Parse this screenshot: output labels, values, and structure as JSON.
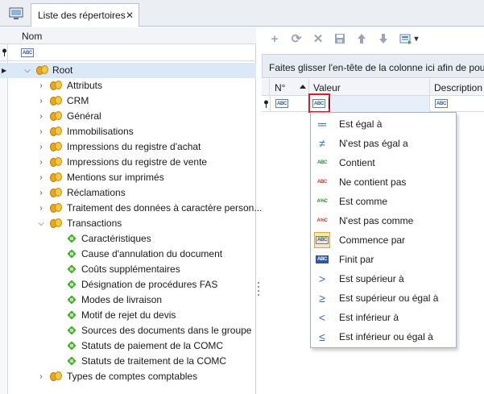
{
  "tabs": {
    "active_label": "Liste des répertoires",
    "close_glyph": "✕",
    "home_icon": "desktop-icon"
  },
  "tree": {
    "column_header": "Nom",
    "filter_icon": "abc-filter-icon",
    "root_label": "Root",
    "nodes": [
      {
        "label": "Attributs",
        "type": "folder",
        "level": 1,
        "expanded": false
      },
      {
        "label": "CRM",
        "type": "folder",
        "level": 1,
        "expanded": false
      },
      {
        "label": "Général",
        "type": "folder",
        "level": 1,
        "expanded": false
      },
      {
        "label": "Immobilisations",
        "type": "folder",
        "level": 1,
        "expanded": false
      },
      {
        "label": "Impressions du registre d'achat",
        "type": "folder",
        "level": 1,
        "expanded": false
      },
      {
        "label": "Impressions du registre de vente",
        "type": "folder",
        "level": 1,
        "expanded": false
      },
      {
        "label": "Mentions sur imprimés",
        "type": "folder",
        "level": 1,
        "expanded": false
      },
      {
        "label": "Réclamations",
        "type": "folder",
        "level": 1,
        "expanded": false
      },
      {
        "label": "Traitement des données à caractère person...",
        "type": "folder",
        "level": 1,
        "expanded": false
      },
      {
        "label": "Transactions",
        "type": "folder",
        "level": 1,
        "expanded": true
      },
      {
        "label": "Caractéristiques",
        "type": "leaf",
        "level": 2
      },
      {
        "label": "Cause d'annulation du document",
        "type": "leaf",
        "level": 2
      },
      {
        "label": "Coûts supplémentaires",
        "type": "leaf",
        "level": 2
      },
      {
        "label": "Désignation de procédures FAS",
        "type": "leaf",
        "level": 2
      },
      {
        "label": "Modes de livraison",
        "type": "leaf",
        "level": 2
      },
      {
        "label": "Motif de rejet du devis",
        "type": "leaf",
        "level": 2
      },
      {
        "label": "Sources des documents dans le groupe",
        "type": "leaf",
        "level": 2
      },
      {
        "label": "Statuts de paiement de la COMC",
        "type": "leaf",
        "level": 2
      },
      {
        "label": "Statuts de traitement de la COMC",
        "type": "leaf",
        "level": 2
      },
      {
        "label": "Types de comptes comptables",
        "type": "folder",
        "level": 1,
        "expanded": false
      }
    ]
  },
  "toolbar": {
    "buttons": [
      "add-icon",
      "refresh-icon",
      "delete-icon",
      "save-icon",
      "move-up-icon",
      "move-down-icon",
      "export-icon"
    ],
    "dropdown_glyph": "▾"
  },
  "grid": {
    "group_hint": "Faites glisser l'en-tête de la colonne ici afin de pouv",
    "columns": {
      "number": "N°",
      "value": "Valeur",
      "description": "Description"
    },
    "filter_abc": "ABC"
  },
  "filter_menu": {
    "items": [
      {
        "label": "Est égal à",
        "icon": "equals-icon",
        "glyph": "═"
      },
      {
        "label": "N'est pas égal a",
        "icon": "not-equal-icon",
        "glyph": "≠"
      },
      {
        "label": "Contient",
        "icon": "contains-icon",
        "glyph": "ABC"
      },
      {
        "label": "Ne contient pas",
        "icon": "not-contains-icon",
        "glyph": "ABC"
      },
      {
        "label": "Est comme",
        "icon": "like-icon",
        "glyph": "A%C"
      },
      {
        "label": "N'est pas comme",
        "icon": "not-like-icon",
        "glyph": "A%C"
      },
      {
        "label": "Commence par",
        "icon": "begins-with-icon",
        "glyph": "ABC",
        "selected": true
      },
      {
        "label": "Finit par",
        "icon": "ends-with-icon",
        "glyph": "ABC"
      },
      {
        "label": "Est supérieur à",
        "icon": "greater-icon",
        "glyph": ">"
      },
      {
        "label": "Est supérieur ou égal à",
        "icon": "greater-equal-icon",
        "glyph": "≥"
      },
      {
        "label": "Est inférieur à",
        "icon": "less-icon",
        "glyph": "<"
      },
      {
        "label": "Est inférieur ou égal à",
        "icon": "less-equal-icon",
        "glyph": "≤"
      }
    ]
  },
  "colors": {
    "accent_blue": "#3a6fb7",
    "selection_orange": "#fde7b1",
    "active_filter_border": "#e0192b",
    "folder_gold": "#f5c842",
    "leaf_green": "#4caf33"
  }
}
